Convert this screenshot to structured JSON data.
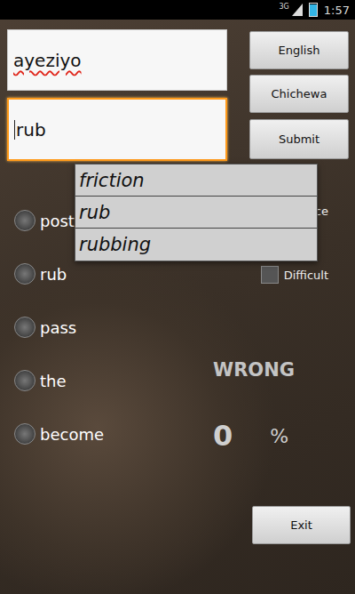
{
  "status_bar": {
    "network": "3G",
    "time": "1:57",
    "battery_level": 0.9
  },
  "fields": [
    {
      "value": "ayeziyo",
      "focused": false,
      "misspelled": true
    },
    {
      "value": "rub",
      "focused": true,
      "misspelled": false
    }
  ],
  "buttons": [
    "English",
    "Chichewa",
    "Submit"
  ],
  "suggestions": [
    "friction",
    "rub",
    "rubbing"
  ],
  "options": [
    {
      "label": "post",
      "selected": false
    },
    {
      "label": "rub",
      "selected": false
    },
    {
      "label": "pass",
      "selected": false
    },
    {
      "label": "the",
      "selected": false
    },
    {
      "label": "become",
      "selected": false
    }
  ],
  "checkboxes": [
    {
      "label": "ce",
      "checked": false
    },
    {
      "label": "Difficult",
      "checked": false
    }
  ],
  "result": "WRONG",
  "score": "0",
  "score_unit": "%",
  "exit_button": "Exit"
}
